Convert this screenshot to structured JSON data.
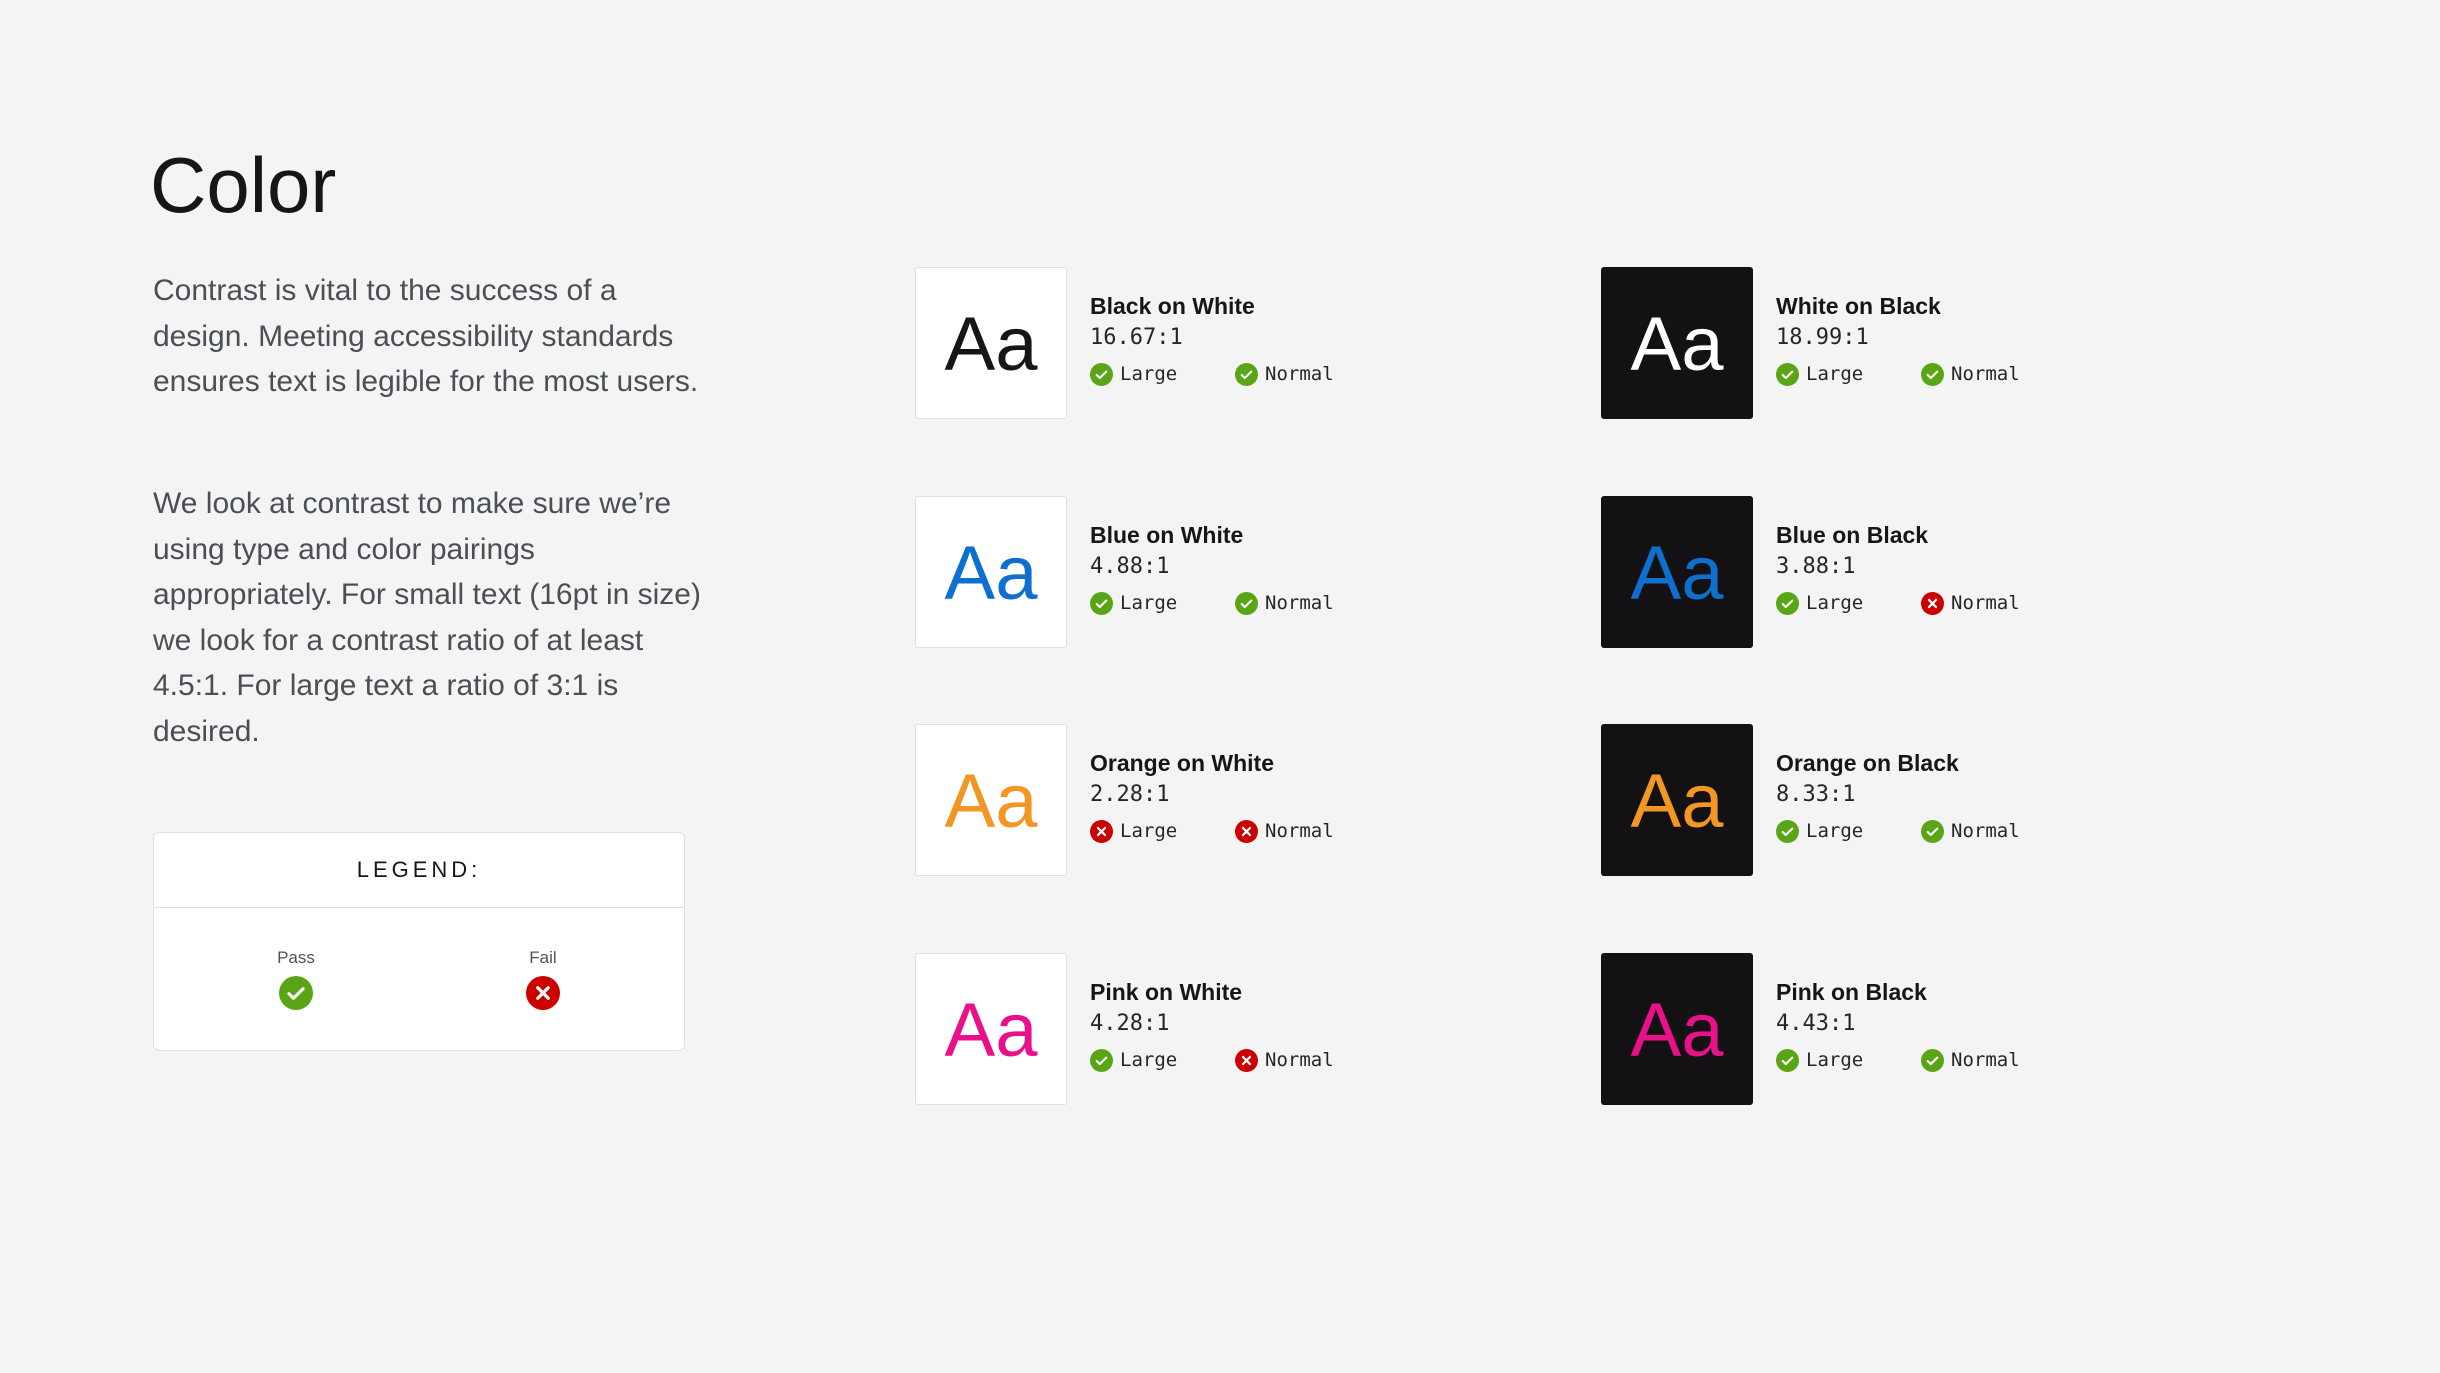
{
  "page": {
    "title": "Color",
    "paragraphs": [
      "Contrast is vital to the success of a design. Meeting accessibility standards ensures text is legible for the most users.",
      "We look at contrast to make sure we’re using type and color pairings appropriately. For small text (16pt in size) we look for a contrast ratio of at least 4.5:1. For large text a ratio of 3:1 is desired."
    ]
  },
  "legend": {
    "title": "LEGEND:",
    "pass_label": "Pass",
    "fail_label": "Fail",
    "pass_icon": "check-circle-icon",
    "fail_icon": "x-circle-icon"
  },
  "colors": {
    "pass": "#5aa516",
    "fail": "#cc0000",
    "black": "#161616",
    "white": "#ffffff",
    "blue": "#0f6fcf",
    "orange": "#f29624",
    "pink": "#e8118a"
  },
  "sample_text": "Aa",
  "check_labels": {
    "large": "Large",
    "normal": "Normal"
  },
  "cards": [
    {
      "name": "Black on White",
      "ratio": "16.67:1",
      "text_color": "#161616",
      "bg": "light",
      "large": "pass",
      "normal": "pass"
    },
    {
      "name": "White on Black",
      "ratio": "18.99:1",
      "text_color": "#ffffff",
      "bg": "dark",
      "large": "pass",
      "normal": "pass"
    },
    {
      "name": "Blue on White",
      "ratio": "4.88:1",
      "text_color": "#0f6fcf",
      "bg": "light",
      "large": "pass",
      "normal": "pass"
    },
    {
      "name": "Blue on Black",
      "ratio": "3.88:1",
      "text_color": "#0f6fcf",
      "bg": "dark",
      "large": "pass",
      "normal": "fail"
    },
    {
      "name": "Orange on White",
      "ratio": "2.28:1",
      "text_color": "#f29624",
      "bg": "light",
      "large": "fail",
      "normal": "fail"
    },
    {
      "name": "Orange on Black",
      "ratio": "8.33:1",
      "text_color": "#f29624",
      "bg": "dark",
      "large": "pass",
      "normal": "pass"
    },
    {
      "name": "Pink on White",
      "ratio": "4.28:1",
      "text_color": "#e8118a",
      "bg": "light",
      "large": "pass",
      "normal": "fail"
    },
    {
      "name": "Pink on Black",
      "ratio": "4.43:1",
      "text_color": "#e8118a",
      "bg": "dark",
      "large": "pass",
      "normal": "pass"
    }
  ]
}
